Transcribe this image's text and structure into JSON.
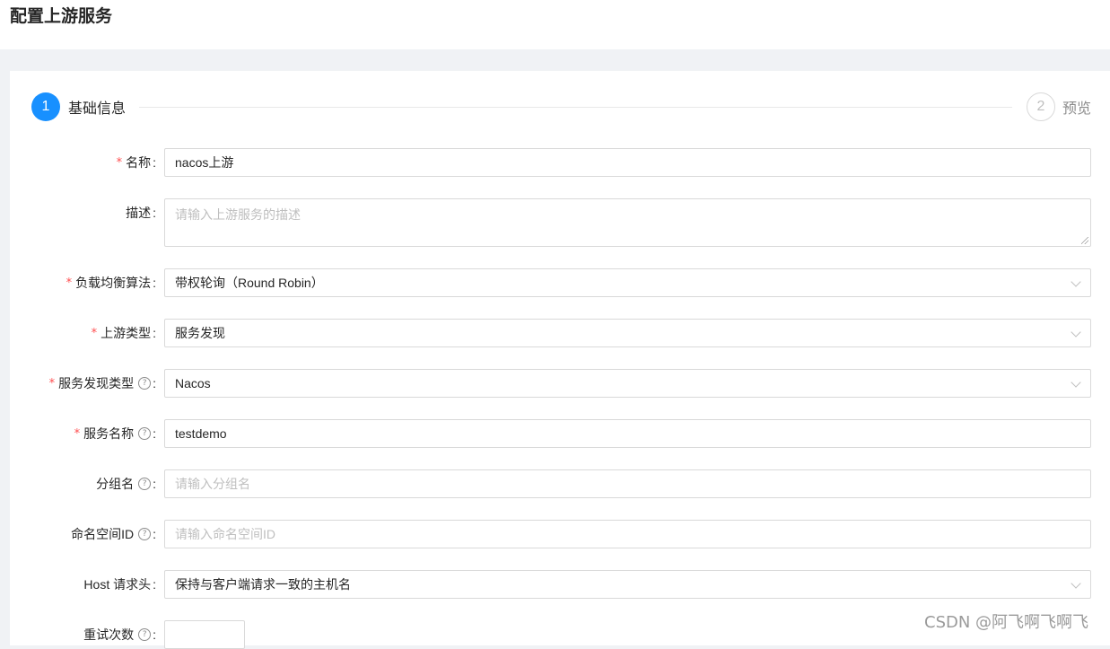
{
  "header": {
    "title": "配置上游服务"
  },
  "steps": [
    {
      "number": "1",
      "label": "基础信息",
      "state": "active"
    },
    {
      "number": "2",
      "label": "预览",
      "state": "pending"
    }
  ],
  "form": {
    "name": {
      "label": "名称",
      "value": "nacos上游",
      "required": true
    },
    "description": {
      "label": "描述",
      "placeholder": "请输入上游服务的描述"
    },
    "load_balance": {
      "label": "负载均衡算法",
      "value": "带权轮询（Round Robin）",
      "required": true
    },
    "upstream_type": {
      "label": "上游类型",
      "value": "服务发现",
      "required": true
    },
    "discovery_type": {
      "label": "服务发现类型",
      "value": "Nacos",
      "required": true
    },
    "service_name": {
      "label": "服务名称",
      "value": "testdemo",
      "required": true
    },
    "group_name": {
      "label": "分组名",
      "placeholder": "请输入分组名"
    },
    "namespace_id": {
      "label": "命名空间ID",
      "placeholder": "请输入命名空间ID"
    },
    "host_header": {
      "label": "Host 请求头",
      "value": "保持与客户端请求一致的主机名"
    },
    "retries": {
      "label": "重试次数"
    }
  },
  "watermark": "CSDN @阿飞啊飞啊飞",
  "colors": {
    "primary": "#1890ff",
    "required": "#ff4d4f",
    "border": "#d9d9d9"
  }
}
